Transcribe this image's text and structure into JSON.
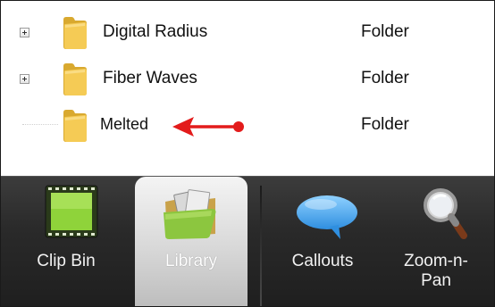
{
  "tree": {
    "rows": [
      {
        "name": "Digital Radius",
        "type": "Folder",
        "expandable": true,
        "icon": "folder-icon"
      },
      {
        "name": "Fiber Waves",
        "type": "Folder",
        "expandable": true,
        "icon": "folder-icon"
      },
      {
        "name": "Melted",
        "type": "Folder",
        "expandable": false,
        "icon": "folder-icon",
        "annotated": true
      }
    ],
    "annotation": {
      "icon": "red-arrow-pointer-icon",
      "color": "#e31b1b"
    }
  },
  "tabs": [
    {
      "label": "Clip Bin",
      "icon": "film-clip-icon",
      "active": false
    },
    {
      "label": "Library",
      "icon": "open-folder-media-icon",
      "active": true
    },
    {
      "label": "Callouts",
      "icon": "speech-bubble-icon",
      "active": false
    },
    {
      "label": "Zoom-n-\nPan",
      "icon": "magnifier-icon",
      "active": false
    }
  ],
  "colors": {
    "folder": "#f0c24a",
    "accent_arrow": "#e31b1b",
    "tabbar": "#2a2a2a"
  }
}
